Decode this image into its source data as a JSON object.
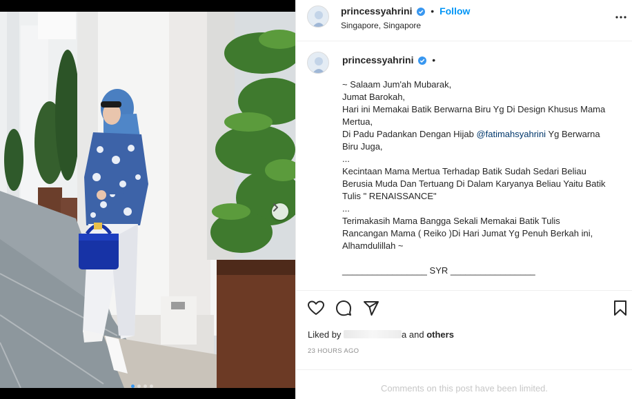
{
  "post": {
    "username": "princessyahrini",
    "follow_label": "Follow",
    "location": "Singapore, Singapore",
    "separator": "•",
    "caption_lines": [
      "~ Salaam Jum'ah Mubarak,",
      "Jumat Barokah,",
      "Hari ini Memakai Batik Berwarna Biru Yg Di Design Khusus Mama",
      "Mertua,",
      "Di Padu Padankan Dengan Hijab",
      "@fatimahsyahrini",
      "Yg Berwarna",
      "Biru Juga,",
      "...",
      "Kecintaan Mama Mertua Terhadap Batik Sudah Sedari Beliau",
      "Berusia Muda Dan Tertuang Di Dalam Karyanya Beliau Yaitu Batik",
      "Tulis \" RENAISSANCE\"",
      "...",
      "Terimakasih Mama Bangga Sekali Memakai Batik Tulis",
      "Rancangan Mama ( Reiko )Di Hari Jumat Yg Penuh Berkah ini,",
      "Alhamdulillah ~",
      "",
      "_________________ SYR _________________"
    ],
    "liked_by_prefix": "Liked by",
    "liked_by_suffix": "a and",
    "liked_by_others": "others",
    "timestamp": "23 HOURS AGO",
    "limited_notice": "Comments on this post have been limited."
  },
  "media": {
    "dots_count": 4,
    "active_dot": 0
  },
  "icons": {
    "verified": "verified-badge-icon",
    "more": "more-options-icon",
    "like": "heart-icon",
    "comment": "comment-icon",
    "share": "paper-plane-icon",
    "save": "bookmark-icon",
    "next": "chevron-right-icon"
  },
  "colors": {
    "accent": "#0095f6",
    "mention": "#00376b",
    "muted": "#8e8e8e"
  }
}
